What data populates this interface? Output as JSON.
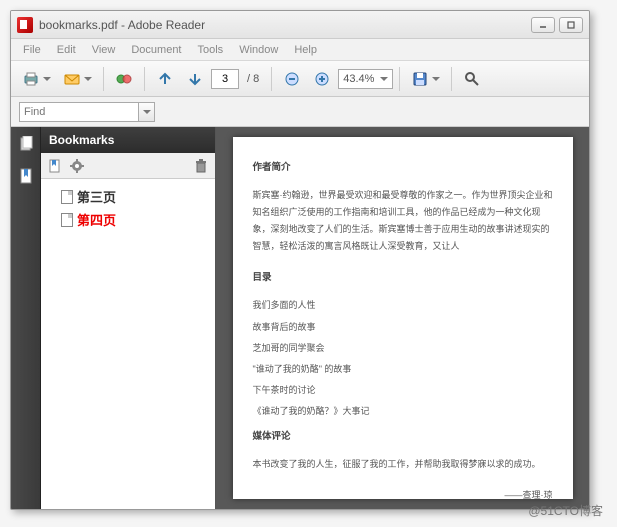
{
  "window": {
    "title": "bookmarks.pdf - Adobe Reader"
  },
  "menu": {
    "file": "File",
    "edit": "Edit",
    "view": "View",
    "document": "Document",
    "tools": "Tools",
    "window": "Window",
    "help": "Help"
  },
  "toolbar": {
    "page_current": "3",
    "page_total": "/ 8",
    "zoom": "43.4%"
  },
  "find": {
    "placeholder": "Find"
  },
  "sidebar": {
    "header": "Bookmarks",
    "items": [
      {
        "label": "第三页",
        "selected": false
      },
      {
        "label": "第四页",
        "selected": true
      }
    ]
  },
  "doc": {
    "h1": "作者简介",
    "p1": "斯宾塞·约翰逊，世界最受欢迎和最受尊敬的作家之一。作为世界顶尖企业和知名组织广泛使用的工作指南和培训工具，他的作品已经成为一种文化现象，深刻地改变了人们的生活。斯宾塞博士善于应用生动的故事讲述现实的智慧，轻松活泼的寓言风格既让人深受教育，又让人",
    "h2": "目录",
    "l1": "我们多面的人性",
    "l2": "故事背后的故事",
    "l3": "芝加哥的同学聚会",
    "l4": "\"谁动了我的奶酪\" 的故事",
    "l5": "下午茶时的讨论",
    "l6": "《谁动了我的奶酪？》大事记",
    "h3": "媒体评论",
    "p2": "本书改变了我的人生，征服了我的工作，并帮助我取得梦寐以求的成功。",
    "sig": "——查理·琼"
  },
  "watermark": "@51CTO博客"
}
